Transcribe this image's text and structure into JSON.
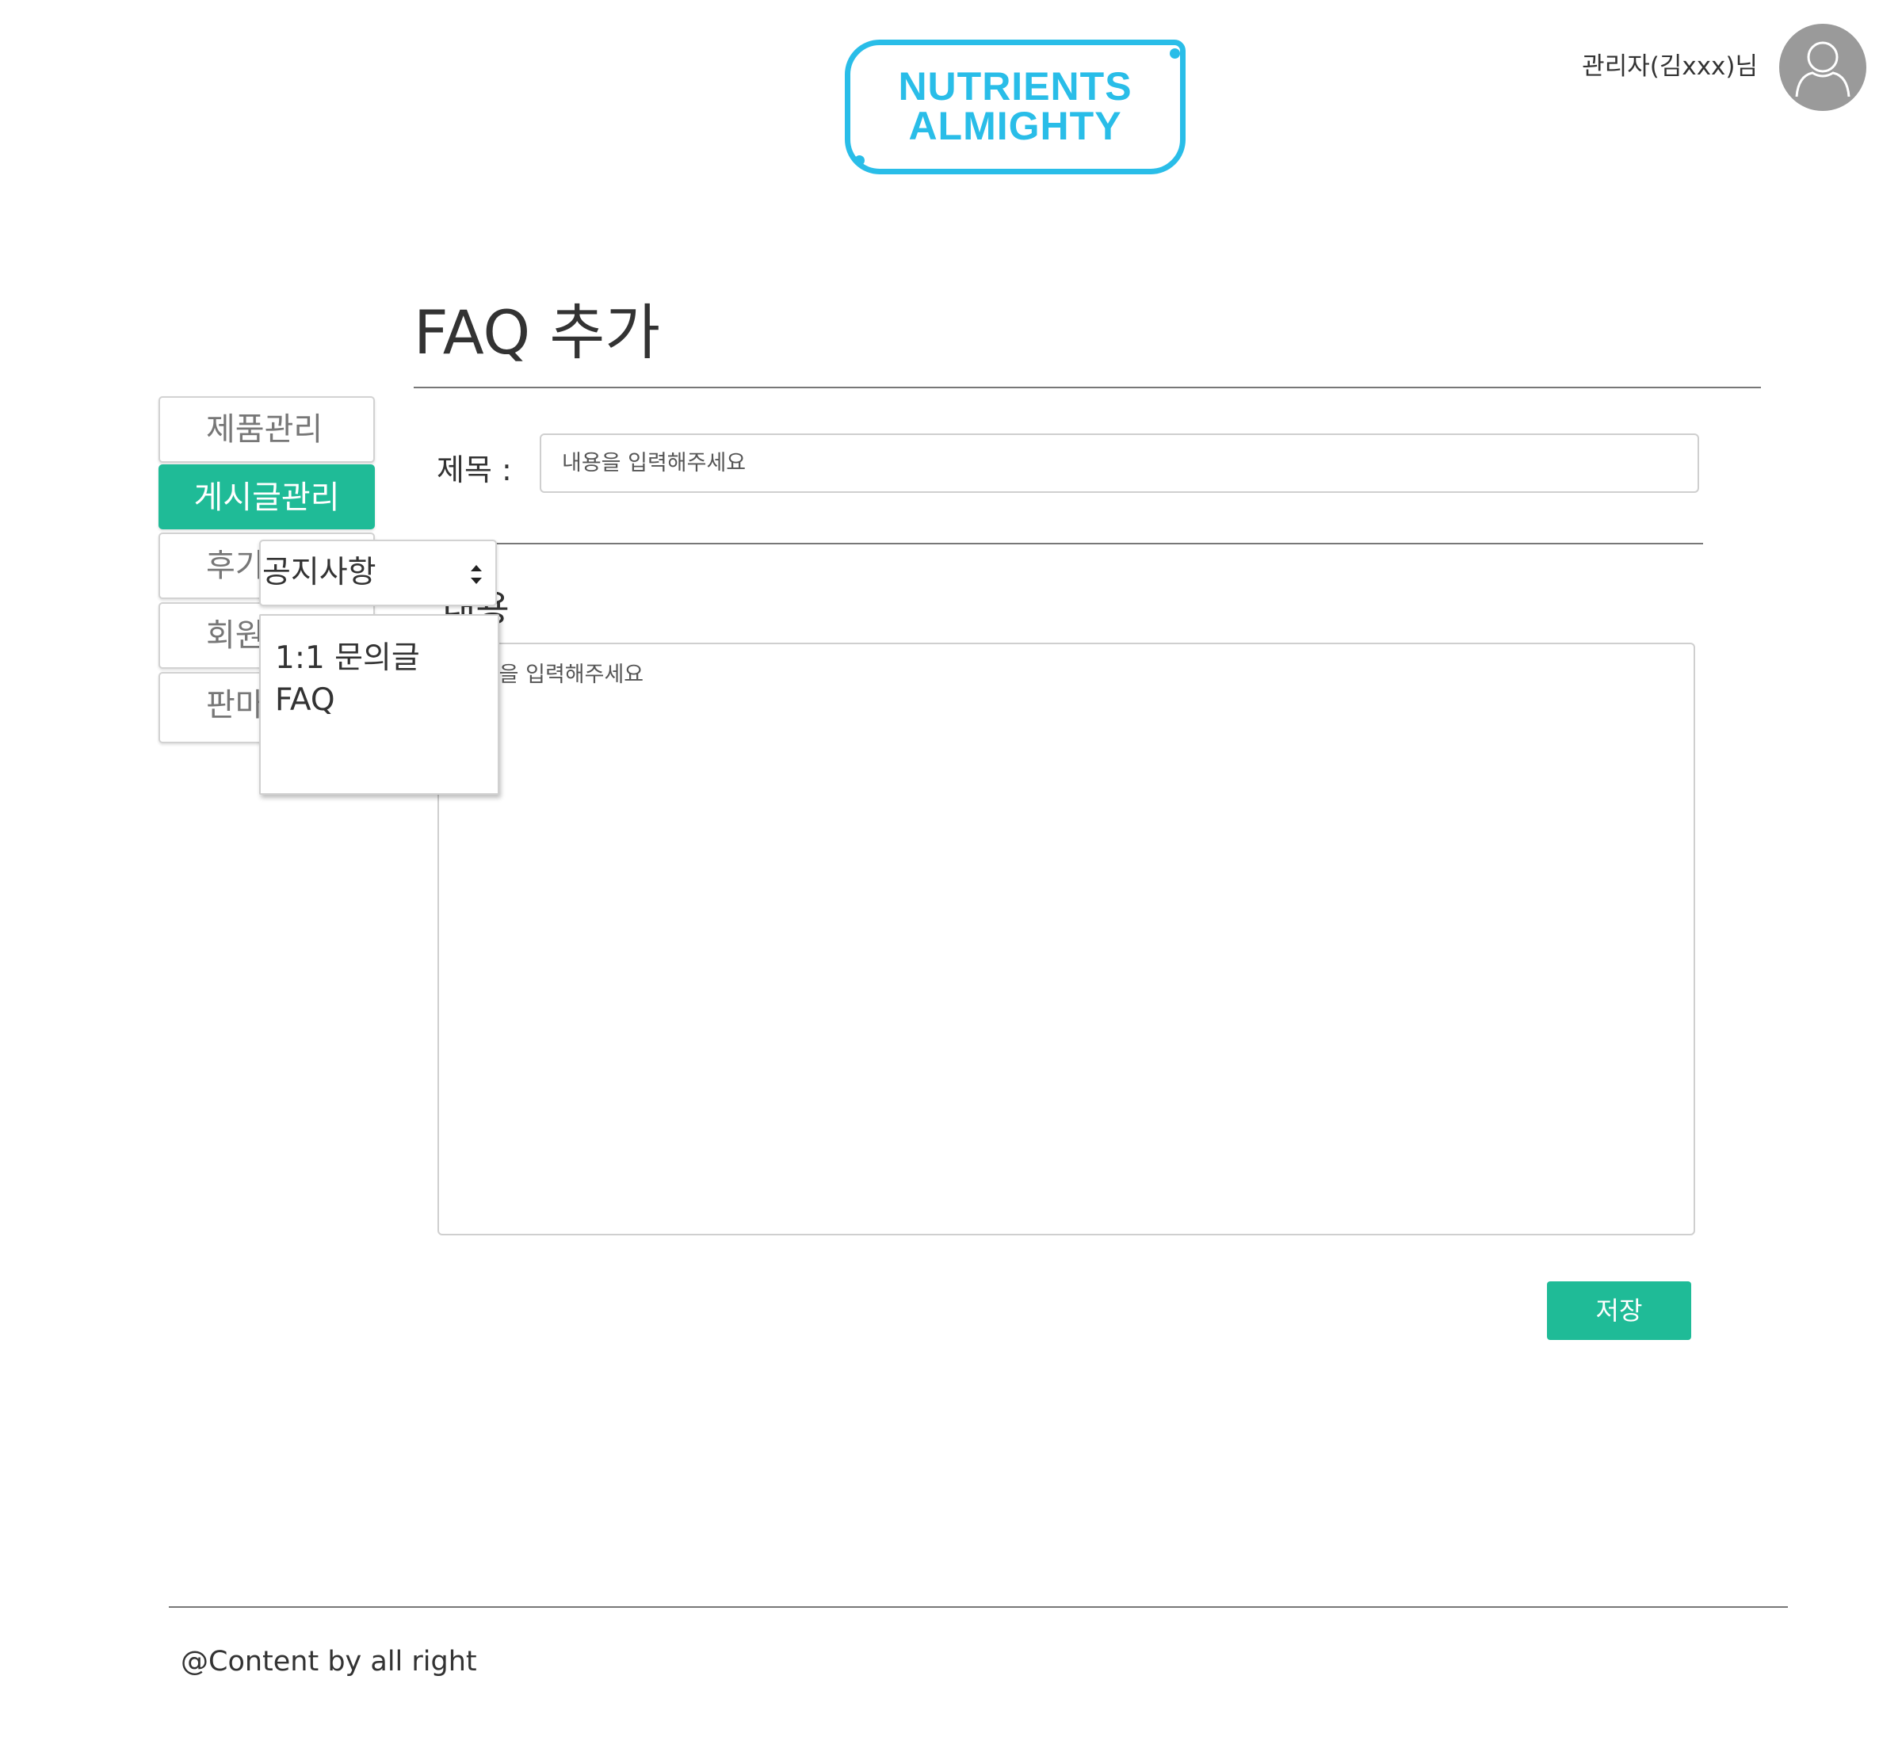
{
  "header": {
    "logo_line1": "NUTRIENTS",
    "logo_line2": "ALMIGHTY",
    "user_name": "관리자(김xxx)님"
  },
  "page": {
    "title": "FAQ 추가"
  },
  "sidebar": {
    "items": [
      {
        "label": "제품관리",
        "active": false
      },
      {
        "label": "게시글관리",
        "active": true
      },
      {
        "label": "후기",
        "active": false
      },
      {
        "label": "회원",
        "active": false
      },
      {
        "label": "판마",
        "active": false
      }
    ]
  },
  "form": {
    "title_label": "제목 :",
    "title_placeholder": "내용을 입력해주세요",
    "content_label": "내용",
    "content_placeholder": "내용을 입력해주세요",
    "save_label": "저장"
  },
  "category_select": {
    "selected": "공지사항",
    "options": [
      "1:1 문의글",
      "FAQ"
    ]
  },
  "footer": {
    "text": "@Content by all right"
  },
  "colors": {
    "accent": "#1fbb97",
    "logo": "#29bde8",
    "avatar": "#9a9a9a"
  },
  "icons": {
    "avatar": "user-icon",
    "select_arrows": "sort-arrows-icon"
  }
}
